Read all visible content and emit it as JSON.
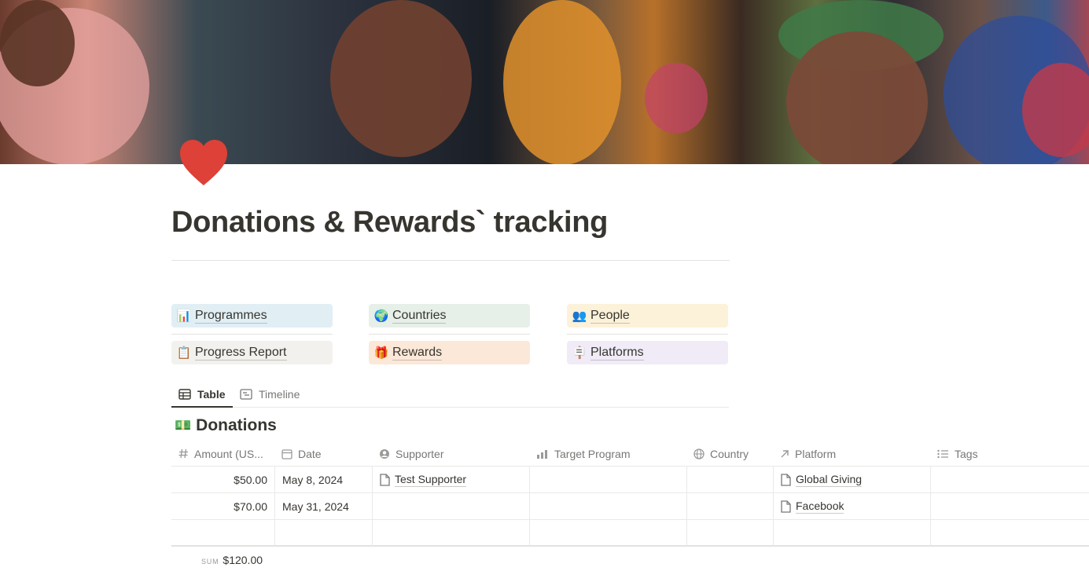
{
  "page": {
    "title": "Donations & Rewards` tracking",
    "icon": "heart-icon"
  },
  "links": [
    {
      "label": "Programmes",
      "icon": "📊",
      "bg": "#e1eff5"
    },
    {
      "label": "Countries",
      "icon": "🌍",
      "bg": "#e6efe8"
    },
    {
      "label": "People",
      "icon": "👥",
      "bg": "#fcf1d9"
    },
    {
      "label": "Progress Report",
      "icon": "📋",
      "bg": "#f2f1ee"
    },
    {
      "label": "Rewards",
      "icon": "🎁",
      "bg": "#fbe8d8"
    },
    {
      "label": "Platforms",
      "icon": "🪧",
      "bg": "#f0ebf7"
    }
  ],
  "tabs": [
    {
      "label": "Table",
      "icon": "table-icon",
      "active": true
    },
    {
      "label": "Timeline",
      "icon": "timeline-icon",
      "active": false
    }
  ],
  "database": {
    "title": "Donations",
    "icon": "💵",
    "columns": [
      {
        "label": "Amount (US...",
        "icon": "number-icon"
      },
      {
        "label": "Date",
        "icon": "calendar-icon"
      },
      {
        "label": "Supporter",
        "icon": "person-icon"
      },
      {
        "label": "Target Program",
        "icon": "chart-icon"
      },
      {
        "label": "Country",
        "icon": "globe-icon"
      },
      {
        "label": "Platform",
        "icon": "relation-arrow-icon"
      },
      {
        "label": "Tags",
        "icon": "list-icon"
      }
    ],
    "rows": [
      {
        "amount": "$50.00",
        "date": "May 8, 2024",
        "supporter": "Test Supporter",
        "target_program": "",
        "country": "",
        "platform": "Global Giving",
        "tags": ""
      },
      {
        "amount": "$70.00",
        "date": "May 31, 2024",
        "supporter": "",
        "target_program": "",
        "country": "",
        "platform": "Facebook",
        "tags": ""
      },
      {
        "amount": "",
        "date": "",
        "supporter": "",
        "target_program": "",
        "country": "",
        "platform": "",
        "tags": ""
      }
    ],
    "sum_label": "SUM",
    "sum_value": "$120.00"
  }
}
